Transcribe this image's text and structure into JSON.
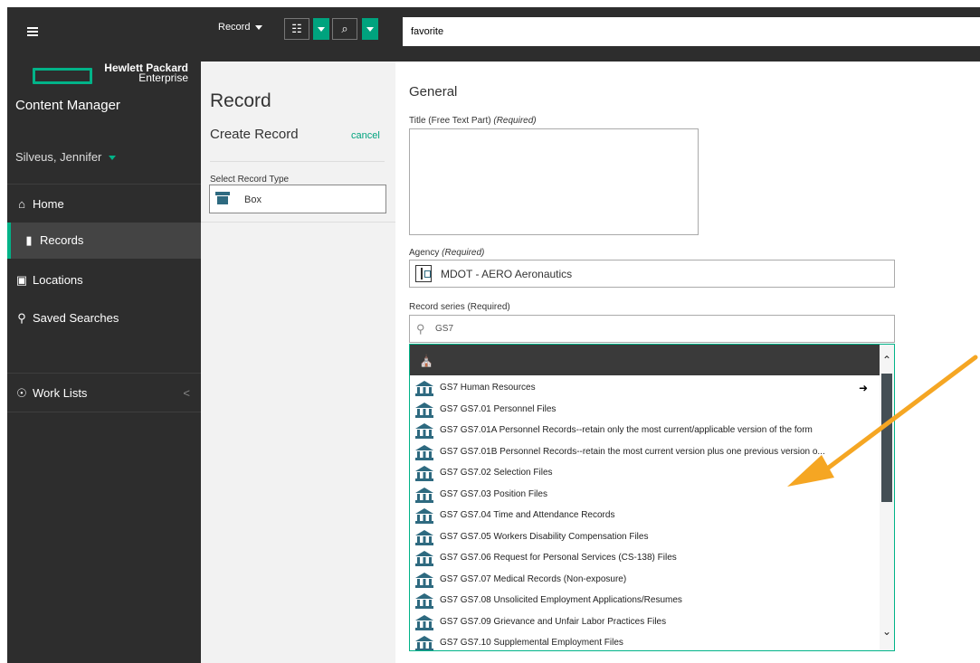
{
  "toolbar": {
    "record_menu": "Record",
    "search_value": "favorite"
  },
  "sidebar": {
    "brand_line1": "Hewlett Packard",
    "brand_line2": "Enterprise",
    "app_title": "Content Manager",
    "user": "Silveus, Jennifer",
    "items": [
      {
        "label": "Home",
        "icon": "home-icon"
      },
      {
        "label": "Records",
        "icon": "document-icon"
      },
      {
        "label": "Locations",
        "icon": "contact-card-icon"
      },
      {
        "label": "Saved Searches",
        "icon": "saved-search-icon"
      },
      {
        "label": "Work Lists",
        "icon": "worklist-icon"
      }
    ],
    "collapse_glyph": "<"
  },
  "middle": {
    "title": "Record",
    "subtitle": "Create Record",
    "cancel": "cancel",
    "record_type_label": "Select Record Type",
    "record_type_value": "Box"
  },
  "main": {
    "section_title": "General",
    "title_label": "Title (Free Text Part)",
    "required": "(Required)",
    "agency_label": "Agency",
    "agency_value": "MDOT - AERO Aeronautics",
    "series_label": "Record series (Required)",
    "series_search": "GS7",
    "series_items": [
      "GS7 Human Resources",
      "GS7 GS7.01 Personnel Files",
      "GS7 GS7.01A Personnel Records--retain only the most current/applicable version of the form",
      "GS7 GS7.01B Personnel Records--retain the most current version plus one previous version o...",
      "GS7 GS7.02 Selection Files",
      "GS7 GS7.03 Position Files",
      "GS7 GS7.04 Time and Attendance Records",
      "GS7 GS7.05 Workers Disability Compensation Files",
      "GS7 GS7.06 Request for Personal Services (CS-138) Files",
      "GS7 GS7.07 Medical Records (Non-exposure)",
      "GS7 GS7.08 Unsolicited Employment Applications/Resumes",
      "GS7 GS7.09 Grievance and Unfair Labor Practices Files",
      "GS7 GS7.10 Supplemental Employment Files"
    ]
  },
  "colors": {
    "accent": "#00b388",
    "dark": "#2d2d2d",
    "icon_teal": "#2e6a80",
    "annotation_arrow": "#f5a623"
  }
}
